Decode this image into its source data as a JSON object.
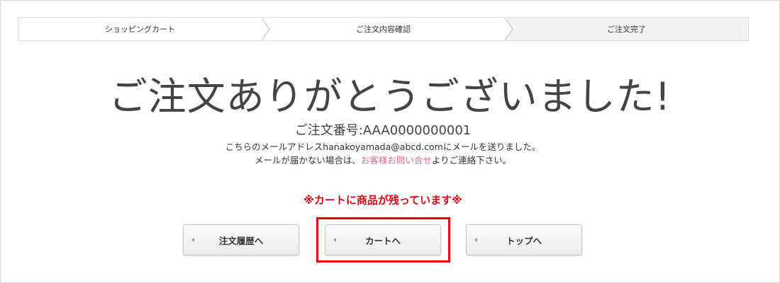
{
  "steps": [
    {
      "label": "ショッピングカート"
    },
    {
      "label": "ご注文内容確認"
    },
    {
      "label": "ご注文完了"
    }
  ],
  "title": "ご注文ありがとうございました!",
  "order_number": "ご注文番号:AAA0000000001",
  "message_line1": "こちらのメールアドレスhanakoyamada@abcd.comにメールを送りました。",
  "message_line2_prefix": "メールが届かない場合は、",
  "message_line2_link": "お客様お問い合せ",
  "message_line2_suffix": "よりご連絡下さい。",
  "notice": "※カートに商品が残っています※",
  "buttons": {
    "history": "注文履歴へ",
    "cart": "カートへ",
    "top": "トップへ"
  },
  "colors": {
    "notice": "#e60012",
    "link": "#e06a87",
    "highlight": "#ee0000"
  }
}
